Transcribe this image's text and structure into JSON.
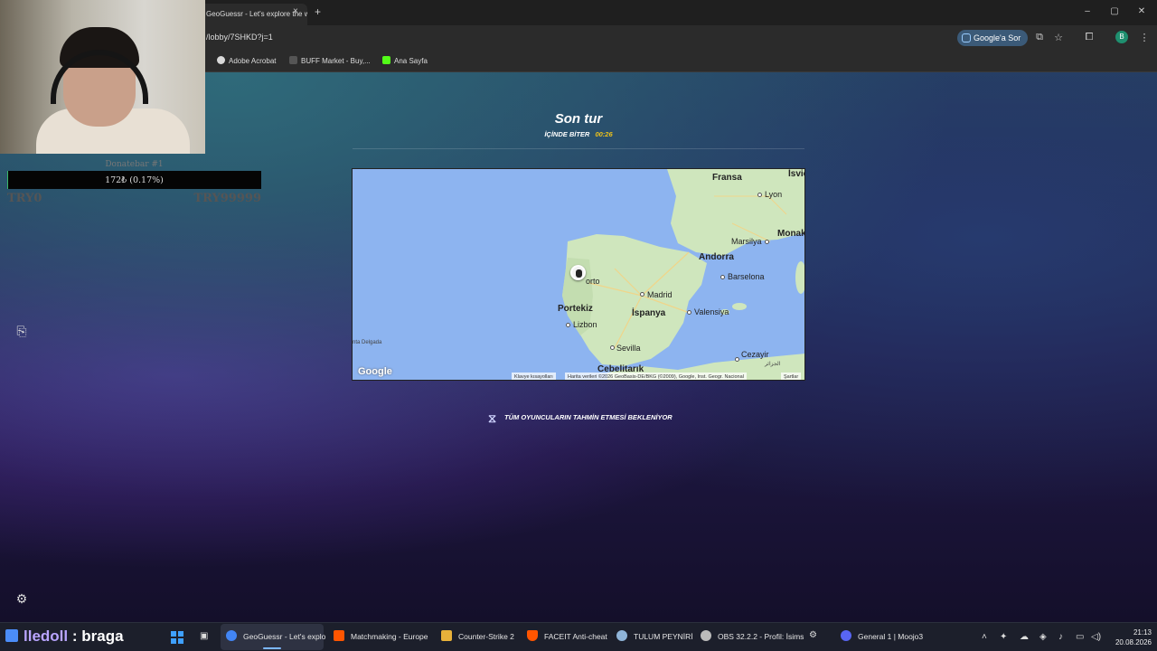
{
  "browser": {
    "tab_title": "GeoGuessr - Let's explore the w...",
    "tab_close": "×",
    "new_tab": "+",
    "url": "/lobby/7SHKD?j=1",
    "ask_google": "Google'a Sor",
    "profile_initial": "B",
    "window_controls": [
      "–",
      "▢",
      "✕"
    ],
    "bookmarks": [
      {
        "label": "Adobe Acrobat",
        "icon": "adobe-icon",
        "color": "#d9d9d9"
      },
      {
        "label": "BUFF Market - Buy,...",
        "icon": "buff-icon",
        "color": "#e0e0e0"
      },
      {
        "label": "Ana Sayfa",
        "icon": "kick-icon",
        "color": "#53fc18"
      }
    ]
  },
  "game": {
    "round_title": "Son tur",
    "timer_label": "İÇİNDE BİTER",
    "timer_value": "00:26",
    "waiting_text": "TÜM OYUNCULARIN TAHMİN ETMESİ BEKLENİYOR"
  },
  "map": {
    "countries": [
      "Fransa",
      "Portekiz",
      "İspanya",
      "Andorra",
      "Monak",
      "İsviç"
    ],
    "cities": [
      "Lyon",
      "Marsilya",
      "Barselona",
      "Madrid",
      "Valensiya",
      "Lizbon",
      "Sevilla",
      "Cezayir",
      "Cebelitarık",
      "orto",
      "nta Delgada",
      "الجزائر"
    ],
    "attribution_google": "Google",
    "attribution_shortcuts": "Klavye kısayolları",
    "attribution_data": "Harita verileri ©2026 GeoBasis-DE/BKG (©2009), Google, Inst. Geogr. Nacional",
    "attribution_terms": "Şartlar",
    "colors": {
      "water": "#8db4f0",
      "land": "#cfe6bd",
      "land_dark": "#b8d7a2"
    }
  },
  "overlay": {
    "donation_title": "Donatebar #1",
    "donation_text": "172₺ (0.17%)",
    "donation_progress_percent": 0.17,
    "donation_min": "TRY0",
    "donation_max": "TRY99999",
    "caption_user": "lledoll",
    "caption_sep": " : ",
    "caption_text": "braga"
  },
  "taskbar": {
    "apps": [
      {
        "label": "GeoGuessr - Let's explo",
        "icon": "chrome-icon",
        "color": "#4285f4"
      },
      {
        "label": "Matchmaking - Europe",
        "icon": "faceit-icon",
        "color": "#ff5500"
      },
      {
        "label": "Counter-Strike 2",
        "icon": "cs2-icon",
        "color": "#e8b13a"
      },
      {
        "label": "FACEIT Anti-cheat",
        "icon": "shield-icon",
        "color": "#ff5500"
      },
      {
        "label": "TULUM PEYNİRİ",
        "icon": "steam-icon",
        "color": "#8fb4d8"
      },
      {
        "label": "OBS 32.2.2 - Profil: İsims",
        "icon": "obs-icon",
        "color": "#bbbbbb"
      },
      {
        "label": "General 1 | Moojo3",
        "icon": "discord-icon",
        "color": "#5865f2"
      }
    ],
    "time": "21:13",
    "date": "20.08.2026"
  }
}
